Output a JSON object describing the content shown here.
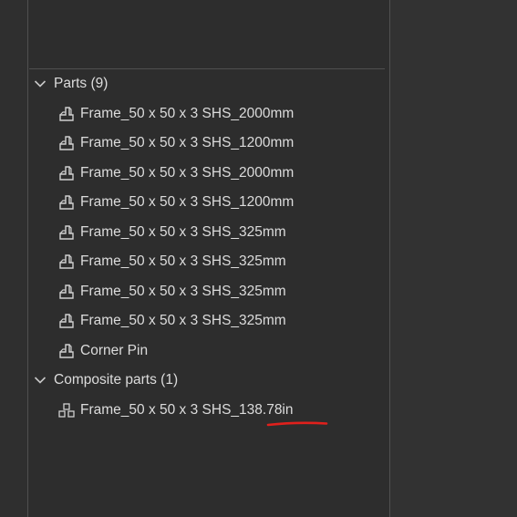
{
  "tree": {
    "groups": [
      {
        "label": "Parts (9)",
        "items": [
          "Frame_50 x 50 x 3 SHS_2000mm",
          "Frame_50 x 50 x 3 SHS_1200mm",
          "Frame_50 x 50 x 3 SHS_2000mm",
          "Frame_50 x 50 x 3 SHS_1200mm",
          "Frame_50 x 50 x 3 SHS_325mm",
          "Frame_50 x 50 x 3 SHS_325mm",
          "Frame_50 x 50 x 3 SHS_325mm",
          "Frame_50 x 50 x 3 SHS_325mm",
          "Corner Pin"
        ]
      },
      {
        "label": "Composite parts (1)",
        "items": [
          "Frame_50 x 50 x 3 SHS_138.78in"
        ]
      }
    ]
  },
  "icons": {
    "chevron": "chevron-down-icon",
    "part": "part-icon",
    "composite": "composite-part-icon"
  },
  "colors": {
    "text": "#dcdcdc",
    "icon": "#d0d0d0",
    "annotation": "#e0201c"
  }
}
